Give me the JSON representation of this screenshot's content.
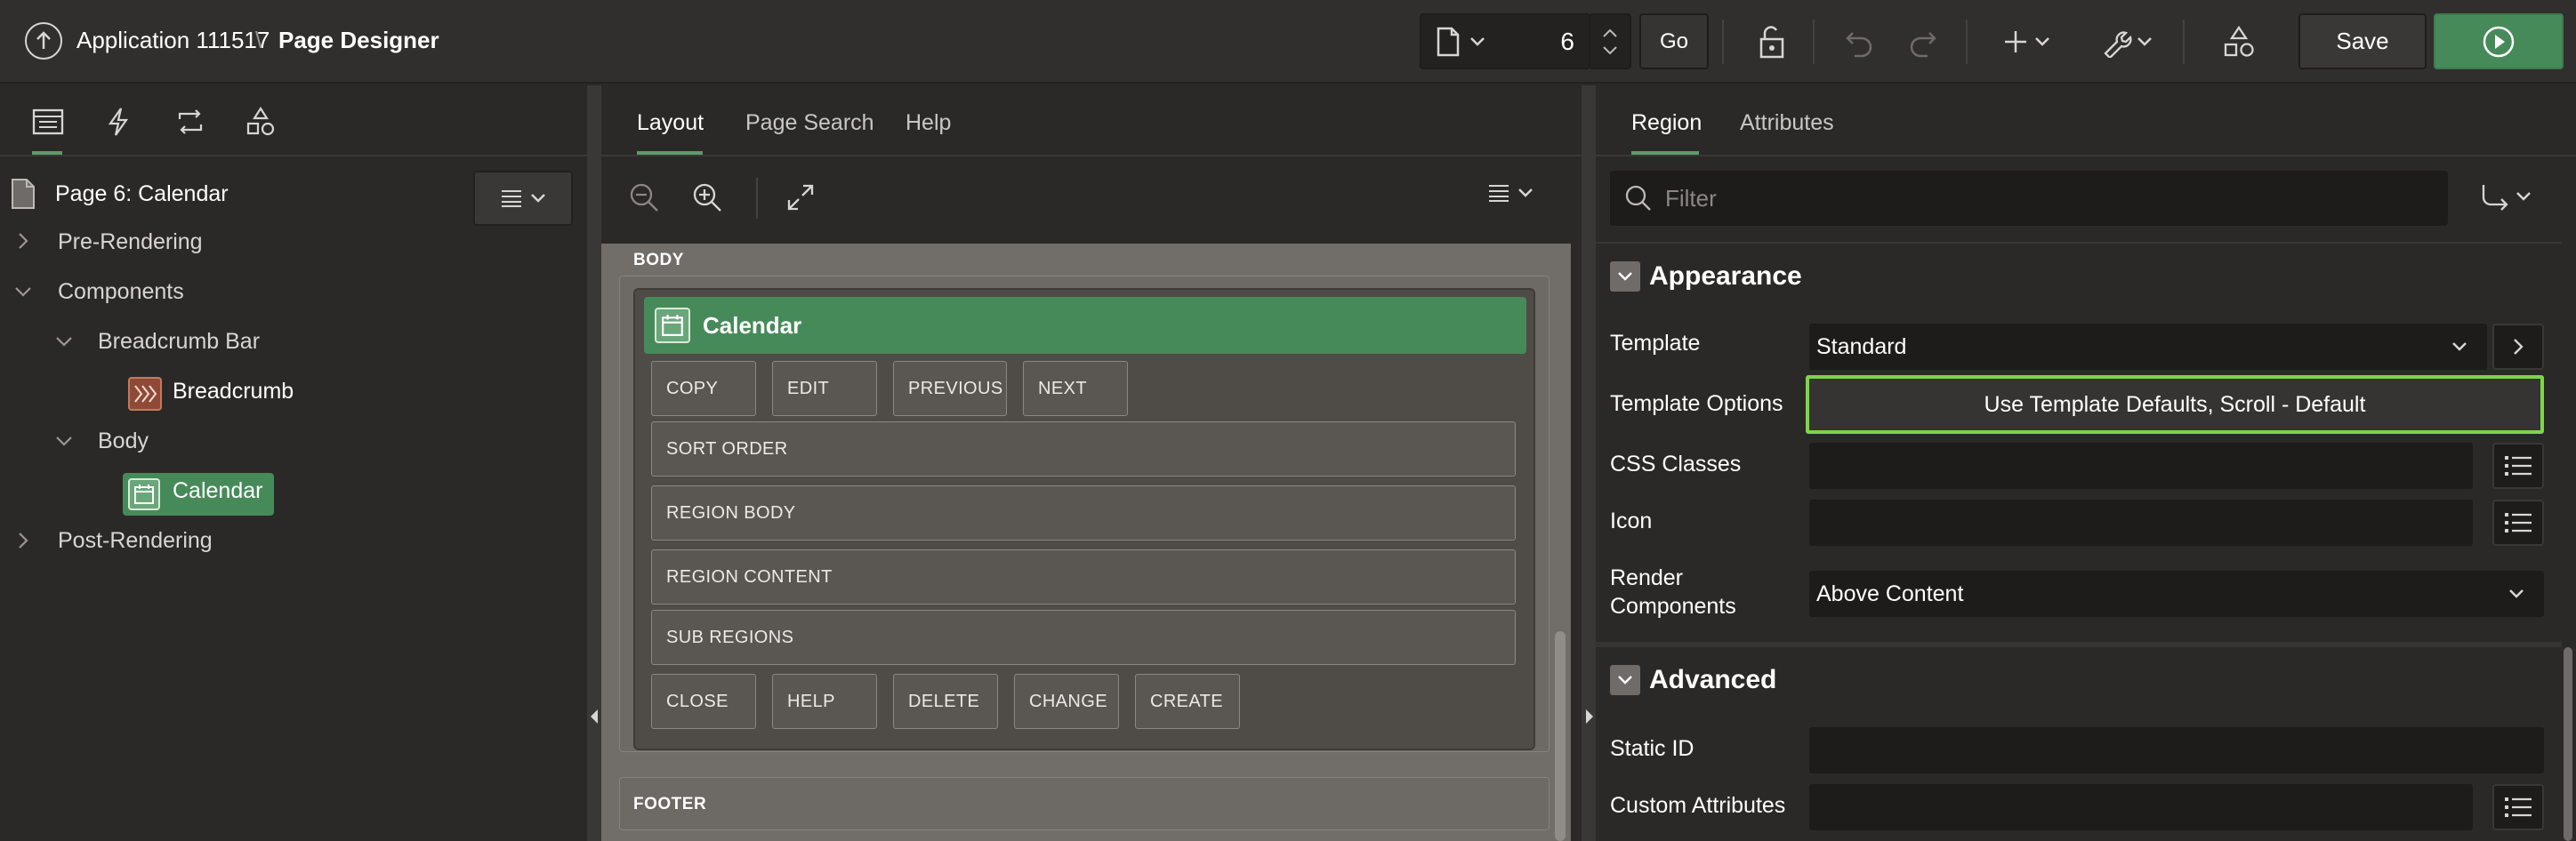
{
  "header": {
    "app_title": "Application 111517",
    "separator": "\\",
    "page_designer": "Page Designer",
    "page_number": "6",
    "go_label": "Go",
    "save_label": "Save"
  },
  "left": {
    "page_title": "Page 6: Calendar",
    "tree": {
      "pre_rendering": "Pre-Rendering",
      "components": "Components",
      "breadcrumb_bar": "Breadcrumb Bar",
      "breadcrumb": "Breadcrumb",
      "body": "Body",
      "calendar": "Calendar",
      "post_rendering": "Post-Rendering"
    }
  },
  "center": {
    "tabs": [
      "Layout",
      "Page Search",
      "Help"
    ],
    "body_label": "BODY",
    "region_title": "Calendar",
    "top_buttons": [
      "COPY",
      "EDIT",
      "PREVIOUS",
      "NEXT"
    ],
    "slots": [
      "SORT ORDER",
      "REGION BODY",
      "REGION CONTENT",
      "SUB REGIONS"
    ],
    "bottom_buttons": [
      "CLOSE",
      "HELP",
      "DELETE",
      "CHANGE",
      "CREATE"
    ],
    "footer_label": "FOOTER"
  },
  "right": {
    "tabs": [
      "Region",
      "Attributes"
    ],
    "filter_placeholder": "Filter",
    "appearance_title": "Appearance",
    "template_label": "Template",
    "template_value": "Standard",
    "template_options_label": "Template Options",
    "template_options_value": "Use Template Defaults, Scroll - Default",
    "css_classes_label": "CSS Classes",
    "icon_label": "Icon",
    "render_components_label_1": "Render",
    "render_components_label_2": "Components",
    "render_components_value": "Above Content",
    "advanced_title": "Advanced",
    "static_id_label": "Static ID",
    "custom_attributes_label": "Custom Attributes"
  },
  "colors": {
    "accent_green": "#478a5a",
    "highlight_outline": "#7bd64a",
    "breadcrumb_icon": "#8e4a36"
  },
  "icons": [
    "up-arrow-icon",
    "page-icon",
    "unlock-icon",
    "undo-icon",
    "redo-icon",
    "plus-icon",
    "wrench-icon",
    "shapes-icon",
    "run-icon",
    "search-icon",
    "calendar-icon",
    "breadcrumb-icon",
    "list-icon"
  ]
}
